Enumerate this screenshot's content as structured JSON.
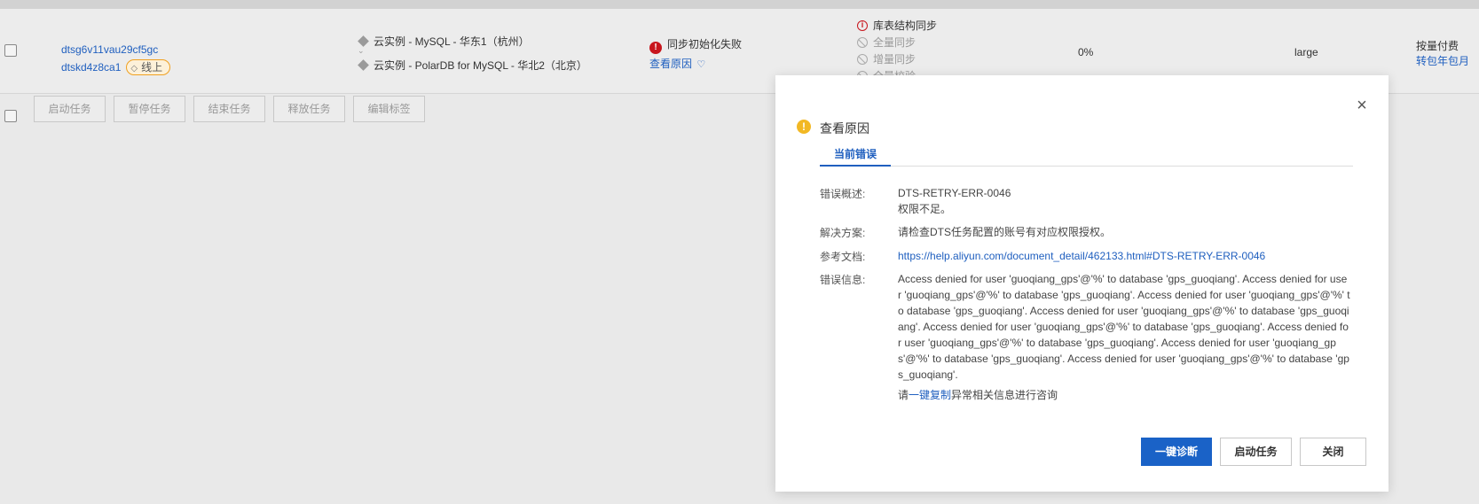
{
  "task_row": {
    "task_id": "dtsg6v11vau29cf5gc",
    "job_id": "dtskd4z8ca1",
    "tag_label": "线上",
    "source_node": "云实例 - MySQL - 华东1（杭州）",
    "target_node": "云实例 - PolarDB for MySQL - 华北2（北京）",
    "status_text": "同步初始化失败",
    "view_reason_link": "查看原因",
    "steps": [
      "库表结构同步",
      "全量同步",
      "增量同步",
      "全量校验"
    ],
    "progress": "0%",
    "spec": "large",
    "billing_type": "按量付费",
    "switch_billing_link": "转包年包月"
  },
  "bulk_actions": [
    "启动任务",
    "暂停任务",
    "结束任务",
    "释放任务",
    "编辑标签"
  ],
  "modal": {
    "title": "查看原因",
    "tab_label": "当前错误",
    "labels": {
      "summary": "错误概述:",
      "solution": "解决方案:",
      "doc": "参考文档:",
      "info": "错误信息:"
    },
    "error_code": "DTS-RETRY-ERR-0046",
    "error_desc": "权限不足。",
    "solution_text": "请检查DTS任务配置的账号有对应权限授权。",
    "doc_link": "https://help.aliyun.com/document_detail/462133.html#DTS-RETRY-ERR-0046",
    "error_message": "Access denied for user 'guoqiang_gps'@'%' to database 'gps_guoqiang'. Access denied for user 'guoqiang_gps'@'%' to database 'gps_guoqiang'. Access denied for user 'guoqiang_gps'@'%' to database 'gps_guoqiang'. Access denied for user 'guoqiang_gps'@'%' to database 'gps_guoqiang'. Access denied for user 'guoqiang_gps'@'%' to database 'gps_guoqiang'. Access denied for user 'guoqiang_gps'@'%' to database 'gps_guoqiang'. Access denied for user 'guoqiang_gps'@'%' to database 'gps_guoqiang'. Access denied for user 'guoqiang_gps'@'%' to database 'gps_guoqiang'.",
    "copy_hint_prefix": "请",
    "copy_link": "一键复制",
    "copy_hint_suffix": "异常相关信息进行咨询",
    "buttons": {
      "diagnose": "一键诊断",
      "start": "启动任务",
      "close": "关闭"
    }
  },
  "colors": {
    "primary": "#1a62c7",
    "link": "#1f5fbf",
    "error": "#c8161d",
    "warning": "#f2b824"
  },
  "icons": {
    "status": "error-icon",
    "heartbeat": "heartbeat-icon",
    "modal_title": "warning-icon",
    "close": "close-icon",
    "tag": "tag-icon"
  }
}
